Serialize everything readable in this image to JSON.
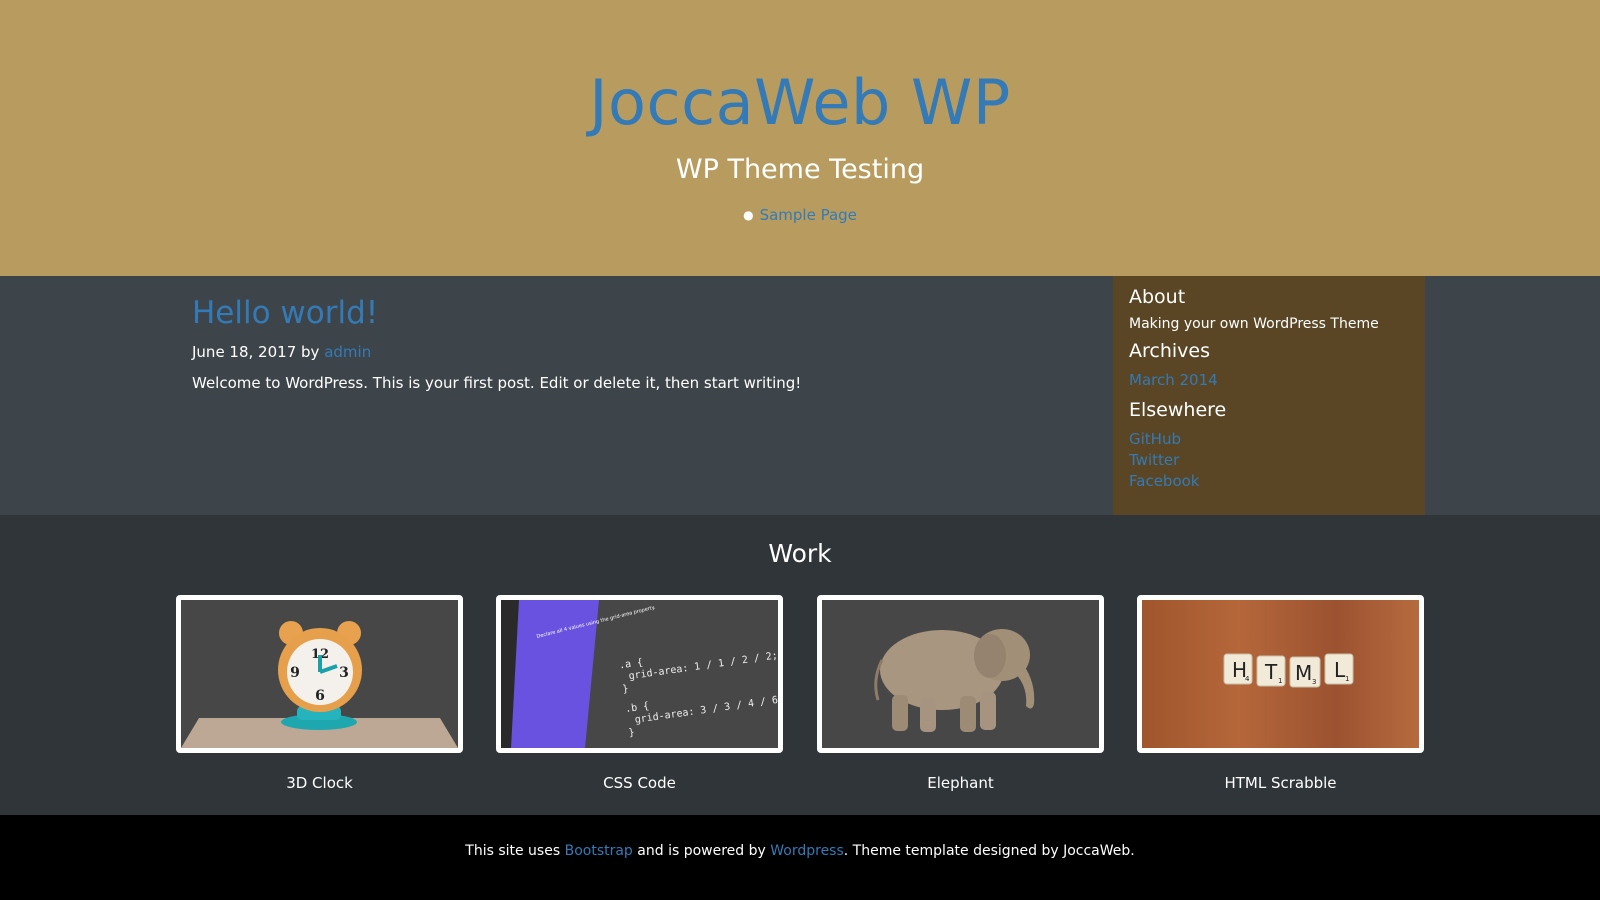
{
  "header": {
    "site_title": "JoccaWeb WP",
    "site_description": "WP Theme Testing",
    "nav": [
      {
        "label": "Sample Page"
      }
    ]
  },
  "post": {
    "title": "Hello world!",
    "date": "June 18, 2017",
    "by": "by",
    "author": "admin",
    "body": "Welcome to WordPress. This is your first post. Edit or delete it, then start writing!"
  },
  "sidebar": {
    "about_heading": "About",
    "about_text": "Making your own WordPress Theme",
    "archives_heading": "Archives",
    "archives": [
      {
        "label": "March 2014"
      }
    ],
    "elsewhere_heading": "Elsewhere",
    "elsewhere": [
      {
        "label": "GitHub"
      },
      {
        "label": "Twitter"
      },
      {
        "label": "Facebook"
      }
    ]
  },
  "work": {
    "heading": "Work",
    "items": [
      {
        "label": "3D Clock"
      },
      {
        "label": "CSS Code"
      },
      {
        "label": "Elephant"
      },
      {
        "label": "HTML Scrabble"
      }
    ],
    "css_code": {
      "caption": "Declare all 4 values using the grid-area property.",
      "line1": ".a {",
      "line2": "grid-area: 1 / 1 / 2 / 2;",
      "line3": "}",
      "line4": ".b {",
      "line5": "grid-area: 3 / 3 / 4 / 6;",
      "line6": "}"
    },
    "scrabble_tiles": [
      {
        "letter": "H",
        "score": "4"
      },
      {
        "letter": "T",
        "score": "1"
      },
      {
        "letter": "M",
        "score": "3"
      },
      {
        "letter": "L",
        "score": "1"
      }
    ]
  },
  "footer": {
    "text1": "This site uses",
    "link1": "Bootstrap",
    "text2": "and is powered by",
    "link2": "Wordpress",
    "text3": ". Theme template designed by JoccaWeb."
  },
  "colors": {
    "header_bg": "#b89c5f",
    "content_bg": "#3e454a",
    "sidebar_bg": "#5a4624",
    "work_bg": "#30353a",
    "footer_bg": "#000000",
    "link": "#337ab7"
  }
}
